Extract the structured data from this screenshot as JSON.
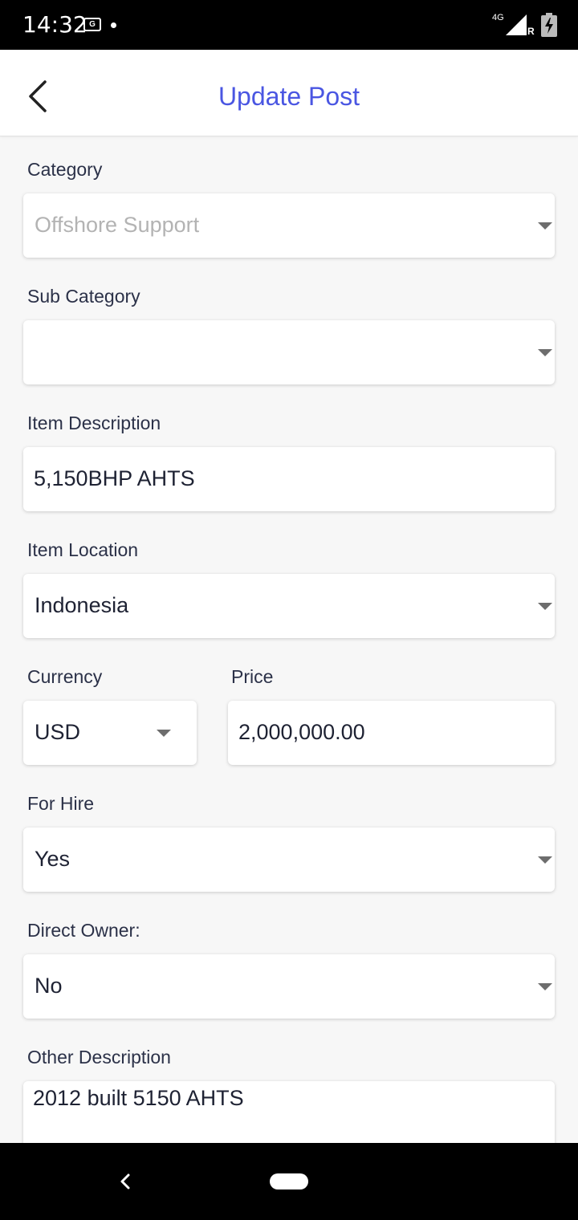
{
  "status_bar": {
    "time": "14:32",
    "notification_badge": "G",
    "network": "4G",
    "roaming": "R"
  },
  "header": {
    "title": "Update Post"
  },
  "form": {
    "category": {
      "label": "Category",
      "value": "Offshore Support"
    },
    "sub_category": {
      "label": "Sub Category",
      "value": ""
    },
    "item_description": {
      "label": "Item Description",
      "value": "5,150BHP AHTS"
    },
    "item_location": {
      "label": "Item Location",
      "value": "Indonesia"
    },
    "currency": {
      "label": "Currency",
      "value": "USD"
    },
    "price": {
      "label": "Price",
      "value": "2,000,000.00"
    },
    "for_hire": {
      "label": "For Hire",
      "value": "Yes"
    },
    "direct_owner": {
      "label": "Direct Owner:",
      "value": "No"
    },
    "other_description": {
      "label": "Other Description",
      "value": "2012 built 5150 AHTS"
    }
  },
  "colors": {
    "accent": "#4a56e2",
    "label": "#2b3148",
    "placeholder": "#b3b3b3"
  }
}
